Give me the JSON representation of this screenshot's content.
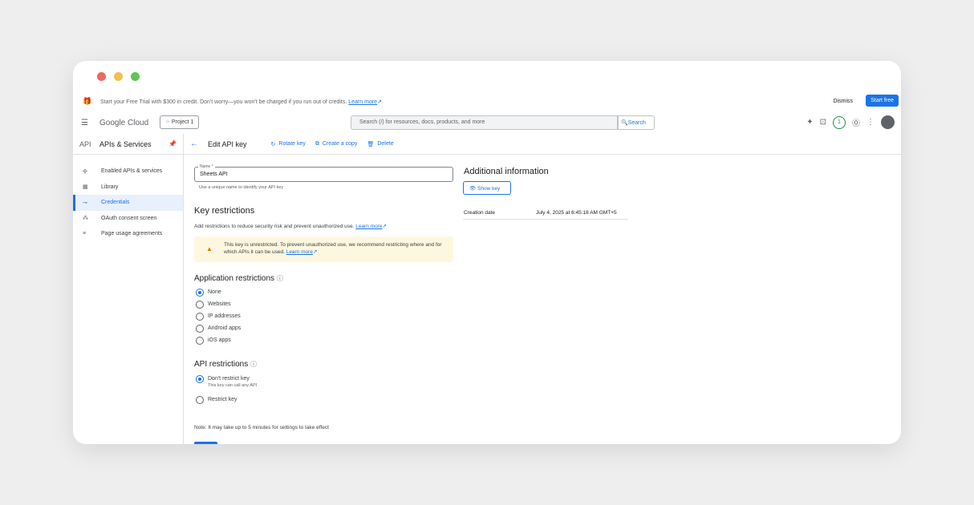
{
  "window": {
    "dots": [
      "#ec6a5e",
      "#f4bf4f",
      "#61c554"
    ]
  },
  "trial": {
    "message": "Start your Free Trial with $300 in credit. Don't worry—you won't be charged if you run out of credits.",
    "learn_more": "Learn more",
    "dismiss": "Dismiss",
    "start_free": "Start free"
  },
  "topbar": {
    "logo": "Google Cloud",
    "project": "Project 1",
    "search_placeholder": "Search (/) for resources, docs, products, and more",
    "search_button": "Search",
    "notification_count": "1"
  },
  "sidebar": {
    "api_label": "API",
    "title": "APIs & Services",
    "items": [
      {
        "label": "Enabled APIs & services",
        "icon": "enabled-apis-icon",
        "glyph": "✣"
      },
      {
        "label": "Library",
        "icon": "library-icon",
        "glyph": "▦"
      },
      {
        "label": "Credentials",
        "icon": "key-icon",
        "glyph": "⊸"
      },
      {
        "label": "OAuth consent screen",
        "icon": "oauth-icon",
        "glyph": "⁂"
      },
      {
        "label": "Page usage agreements",
        "icon": "agreements-icon",
        "glyph": "≡"
      }
    ],
    "active_index": 2
  },
  "actionbar": {
    "title": "Edit API key",
    "rotate": "Rotate key",
    "copy": "Create a copy",
    "delete": "Delete"
  },
  "form": {
    "name_label": "Name *",
    "name_value": "Sheets API",
    "name_help": "Use a unique name to identify your API key",
    "key_restrictions_title": "Key restrictions",
    "key_restrictions_desc": "Add restrictions to reduce security risk and prevent unauthorized use.",
    "learn_more": "Learn more",
    "warning_text": "This key is unrestricted. To prevent unauthorized use, we recommend restricting where and for which APIs it can be used.",
    "warning_link": "Learn more",
    "app_restrictions_title": "Application restrictions",
    "app_options": [
      "None",
      "Websites",
      "IP addresses",
      "Android apps",
      "iOS apps"
    ],
    "app_selected": 0,
    "api_restrictions_title": "API restrictions",
    "api_options": [
      {
        "label": "Don't restrict key",
        "sub": "This key can call any API"
      },
      {
        "label": "Restrict key",
        "sub": ""
      }
    ],
    "api_selected": 0,
    "footer_note": "Note: It may take up to 5 minutes for settings to take effect"
  },
  "info": {
    "title": "Additional information",
    "show_key": "Show key",
    "creation_label": "Creation date",
    "creation_value": "July 4, 2025 at 6:45:18 AM GMT+5"
  }
}
